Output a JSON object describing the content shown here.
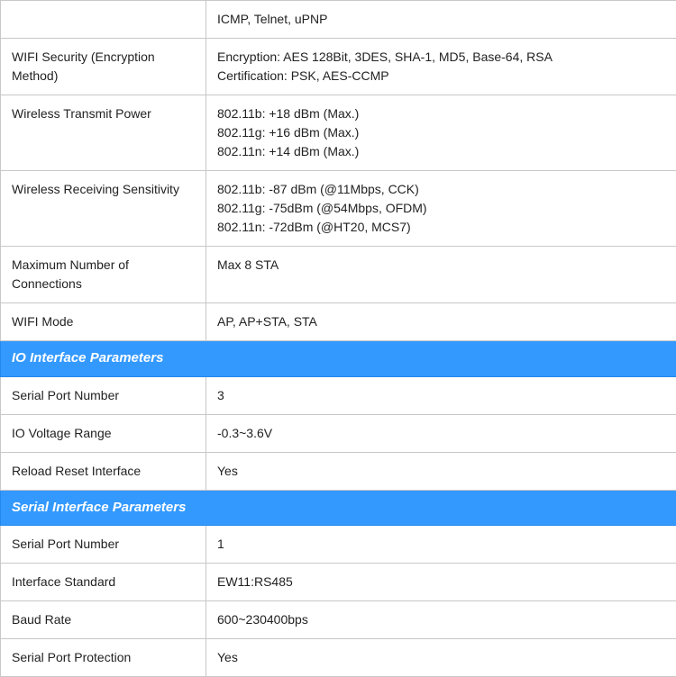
{
  "table": {
    "columns": [
      "label",
      "value"
    ],
    "sections": [
      {
        "type": "data-rows",
        "rows": [
          {
            "label": "",
            "value": "ICMP, Telnet, uPNP"
          },
          {
            "label": "WIFI Security (Encryption Method)",
            "value": "Encryption: AES 128Bit, 3DES, SHA-1, MD5, Base-64, RSA\nCertification: PSK, AES-CCMP"
          },
          {
            "label": "Wireless Transmit Power",
            "value": "802.11b: +18 dBm (Max.)\n802.11g: +16 dBm (Max.)\n802.11n: +14 dBm (Max.)"
          },
          {
            "label": "Wireless Receiving Sensitivity",
            "value": "802.11b: -87 dBm (@11Mbps, CCK)\n802.11g: -75dBm (@54Mbps, OFDM)\n802.11n: -72dBm (@HT20, MCS7)"
          },
          {
            "label": "Maximum Number of Connections",
            "value": "Max 8 STA"
          },
          {
            "label": "WIFI Mode",
            "value": "AP, AP+STA, STA"
          }
        ]
      },
      {
        "type": "section-header",
        "title": "IO Interface Parameters"
      },
      {
        "type": "data-rows",
        "rows": [
          {
            "label": "Serial Port Number",
            "value": "3"
          },
          {
            "label": "IO Voltage Range",
            "value": "-0.3~3.6V"
          },
          {
            "label": "Reload Reset Interface",
            "value": "Yes"
          }
        ]
      },
      {
        "type": "section-header",
        "title": "Serial Interface Parameters"
      },
      {
        "type": "data-rows",
        "rows": [
          {
            "label": "Serial Port Number",
            "value": "1"
          },
          {
            "label": "Interface Standard",
            "value": "EW11:RS485"
          },
          {
            "label": "Baud Rate",
            "value": "600~230400bps"
          },
          {
            "label": "Serial Port Protection",
            "value": "Yes"
          }
        ]
      }
    ]
  }
}
